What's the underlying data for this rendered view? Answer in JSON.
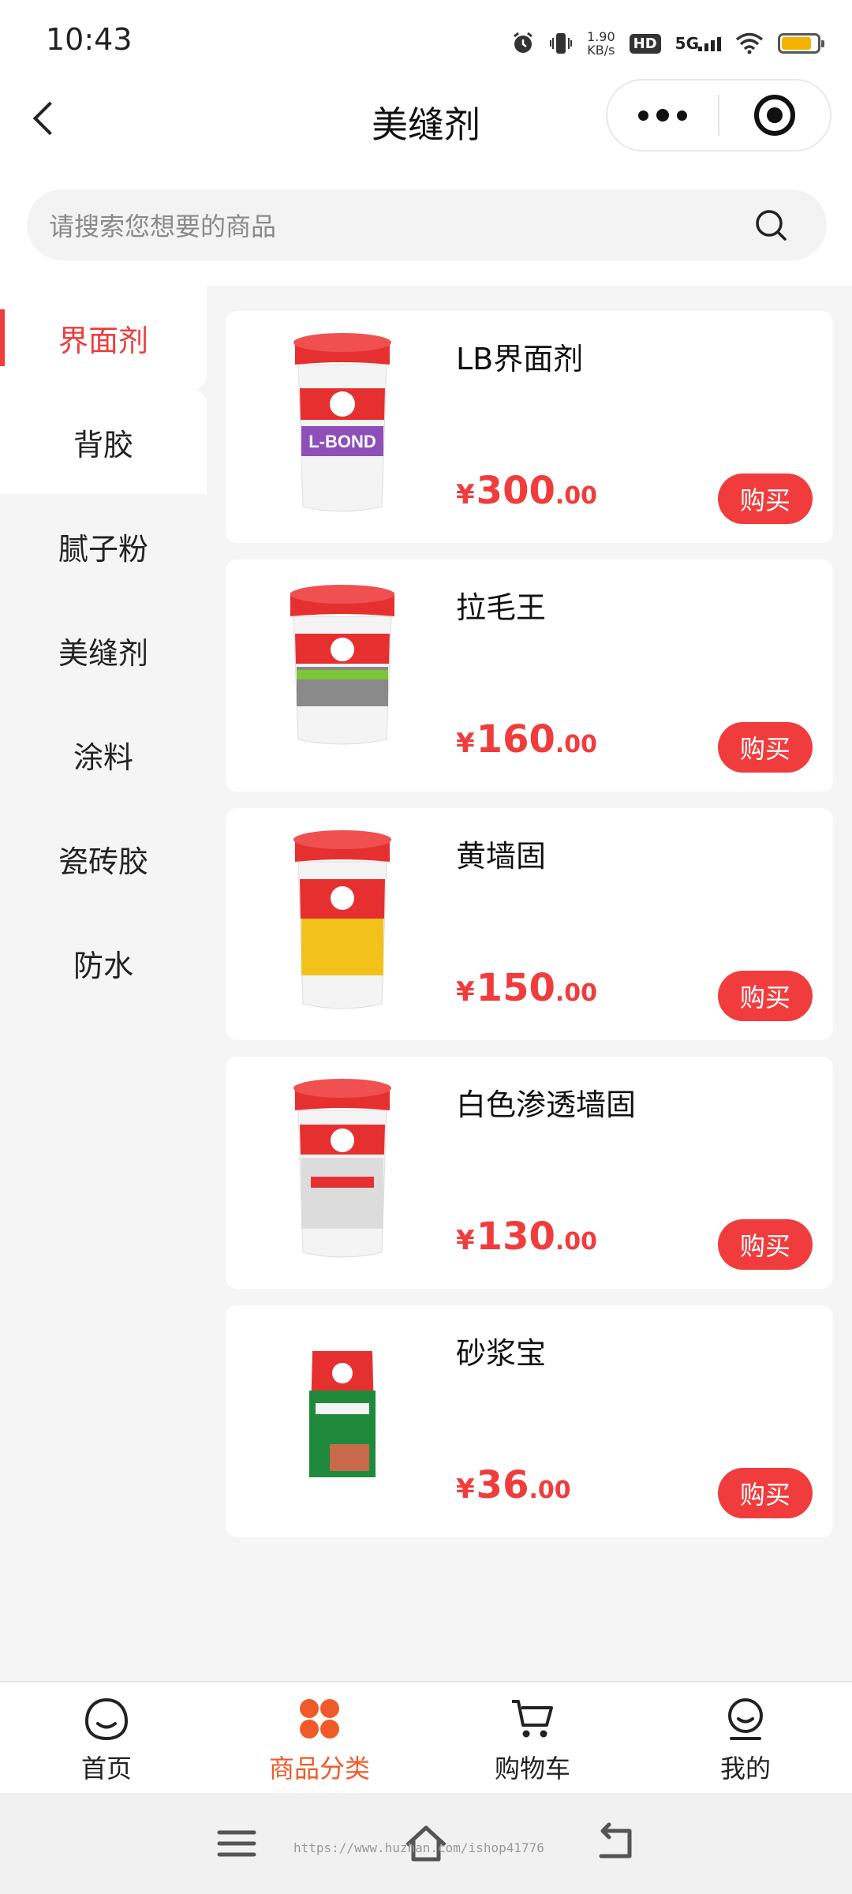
{
  "status_bar": {
    "time": "10:43",
    "net_speed_value": "1.90",
    "net_speed_unit": "KB/s",
    "hd": "HD",
    "network": "5G",
    "battery_level": 0.85
  },
  "nav": {
    "title": "美缝剂"
  },
  "search": {
    "placeholder": "请搜索您想要的商品"
  },
  "categories": [
    {
      "label": "界面剂",
      "active": true
    },
    {
      "label": "背胶"
    },
    {
      "label": "腻子粉"
    },
    {
      "label": "美缝剂"
    },
    {
      "label": "涂料"
    },
    {
      "label": "瓷砖胶"
    },
    {
      "label": "防水"
    }
  ],
  "products": [
    {
      "name": "LB界面剂",
      "currency": "¥",
      "price_int": "300",
      "price_dec": ".00",
      "buy_label": "购买",
      "label_color": "#8e4fb8",
      "label_text": "L-BOND"
    },
    {
      "name": "拉毛王",
      "currency": "¥",
      "price_int": "160",
      "price_dec": ".00",
      "buy_label": "购买",
      "label_color": "#8a8a8a",
      "label_text": ""
    },
    {
      "name": "黄墙固",
      "currency": "¥",
      "price_int": "150",
      "price_dec": ".00",
      "buy_label": "购买",
      "label_color": "#f2c21a",
      "label_text": ""
    },
    {
      "name": "白色渗透墙固",
      "currency": "¥",
      "price_int": "130",
      "price_dec": ".00",
      "buy_label": "购买",
      "label_color": "#dcdcdc",
      "label_text": ""
    },
    {
      "name": "砂浆宝",
      "currency": "¥",
      "price_int": "36",
      "price_dec": ".00",
      "buy_label": "购买",
      "label_color": "#1f8a3c",
      "label_text": ""
    }
  ],
  "tab_bar": [
    {
      "label": "首页",
      "icon": "home-face-icon"
    },
    {
      "label": "商品分类",
      "icon": "category-grid-icon",
      "active": true
    },
    {
      "label": "购物车",
      "icon": "cart-icon"
    },
    {
      "label": "我的",
      "icon": "profile-icon"
    }
  ],
  "watermark": "https://www.huzhan.com/ishop41776",
  "colors": {
    "accent_red": "#f03c3c",
    "tab_active": "#f05a28",
    "battery": "#f5b300"
  }
}
